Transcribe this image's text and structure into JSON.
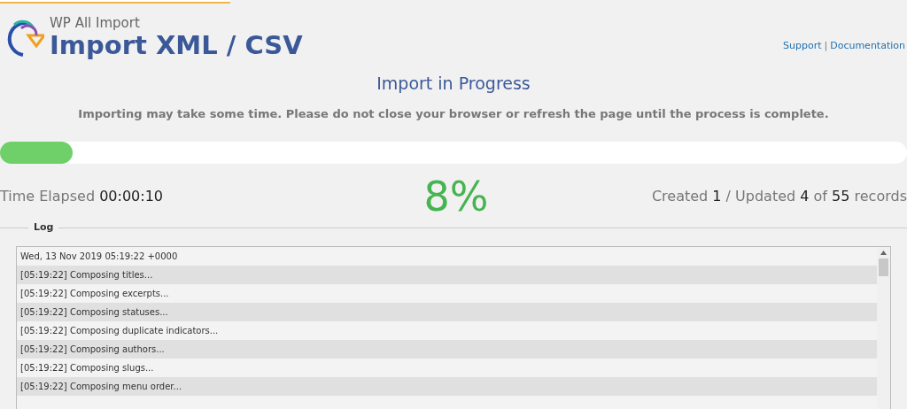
{
  "header": {
    "brand": "WP All Import",
    "title": "Import XML / CSV",
    "links": [
      "Support",
      "Documentation"
    ],
    "separator": "|"
  },
  "status": {
    "heading": "Import in Progress",
    "notice": "Importing may take some time. Please do not close your browser or refresh the page until the process is complete."
  },
  "progress": {
    "level": 0.08
  },
  "stats": {
    "elapsed_label": "Time Elapsed",
    "elapsed": "00:00:10",
    "percent": "8%",
    "created_label": "Created",
    "created": "1",
    "separator": "/",
    "updated_label": "Updated",
    "updated": "4",
    "of_label": "of",
    "total": "55",
    "records_label": "records"
  },
  "log": {
    "legend": "Log",
    "lines": [
      "Wed, 13 Nov 2019 05:19:22 +0000",
      "[05:19:22] Composing titles...",
      "[05:19:22] Composing excerpts...",
      "[05:19:22] Composing statuses...",
      "[05:19:22] Composing duplicate indicators...",
      "[05:19:22] Composing authors...",
      "[05:19:22] Composing slugs...",
      "[05:19:22] Composing menu order..."
    ]
  }
}
